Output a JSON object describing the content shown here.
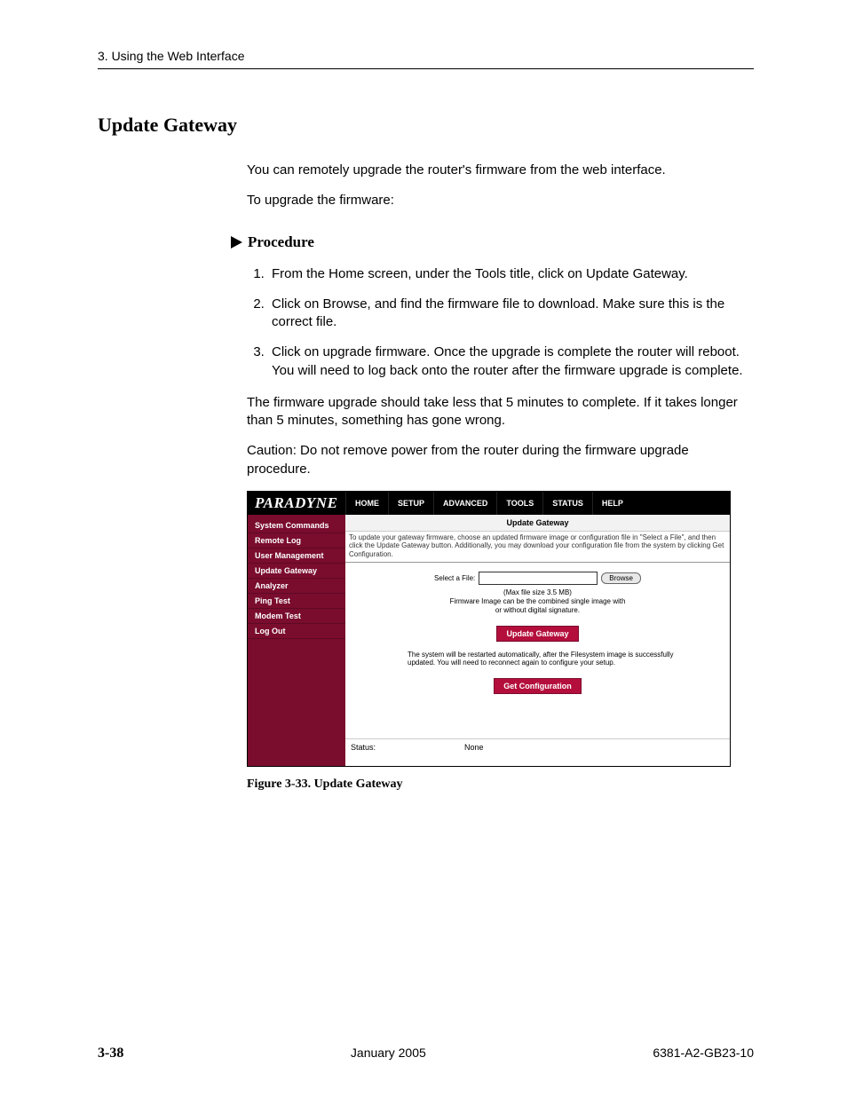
{
  "header": {
    "running": "3. Using the Web Interface"
  },
  "section": {
    "title": "Update Gateway"
  },
  "body": {
    "intro1": "You can remotely upgrade the router's firmware from the web interface.",
    "intro2": "To upgrade the firmware:",
    "procedure_label": "Procedure",
    "steps": [
      "From the Home screen, under the Tools title, click on Update Gateway.",
      "Click on Browse, and find the firmware file to download. Make sure this is the correct file.",
      "Click on upgrade firmware. Once the upgrade is complete the router will reboot. You will need to log back onto the router after the firmware upgrade is complete."
    ],
    "post1": "The firmware upgrade should take less that 5 minutes to complete. If it takes longer than 5 minutes, something has gone wrong.",
    "post2": "Caution: Do not remove power from the router during the firmware upgrade procedure."
  },
  "ui": {
    "brand": "PARADYNE",
    "tabs": [
      "HOME",
      "SETUP",
      "ADVANCED",
      "TOOLS",
      "STATUS",
      "HELP"
    ],
    "sidebar": [
      "System Commands",
      "Remote Log",
      "User Management",
      "Update Gateway",
      "Analyzer",
      "Ping Test",
      "Modem Test",
      "Log Out"
    ],
    "panel_title": "Update Gateway",
    "panel_desc": "To update your gateway firmware, choose an updated firmware image or configuration file in \"Select a File\", and then click the Update Gateway button. Additionally, you may download your configuration file from the system by clicking Get Configuration.",
    "select_label": "Select a File:",
    "browse": "Browse",
    "hint1": "(Max file size 3.5 MB)",
    "hint2": "Firmware Image can be the combined single image with or without digital signature.",
    "update_btn": "Update Gateway",
    "restart_note": "The system will be restarted automatically, after the Filesystem image is successfully updated. You will need to reconnect again to configure your setup.",
    "getconf_btn": "Get Configuration",
    "status_label": "Status:",
    "status_value": "None"
  },
  "figure": {
    "caption": "Figure 3-33.   Update Gateway"
  },
  "footer": {
    "page": "3-38",
    "center": "January 2005",
    "right": "6381-A2-GB23-10"
  }
}
